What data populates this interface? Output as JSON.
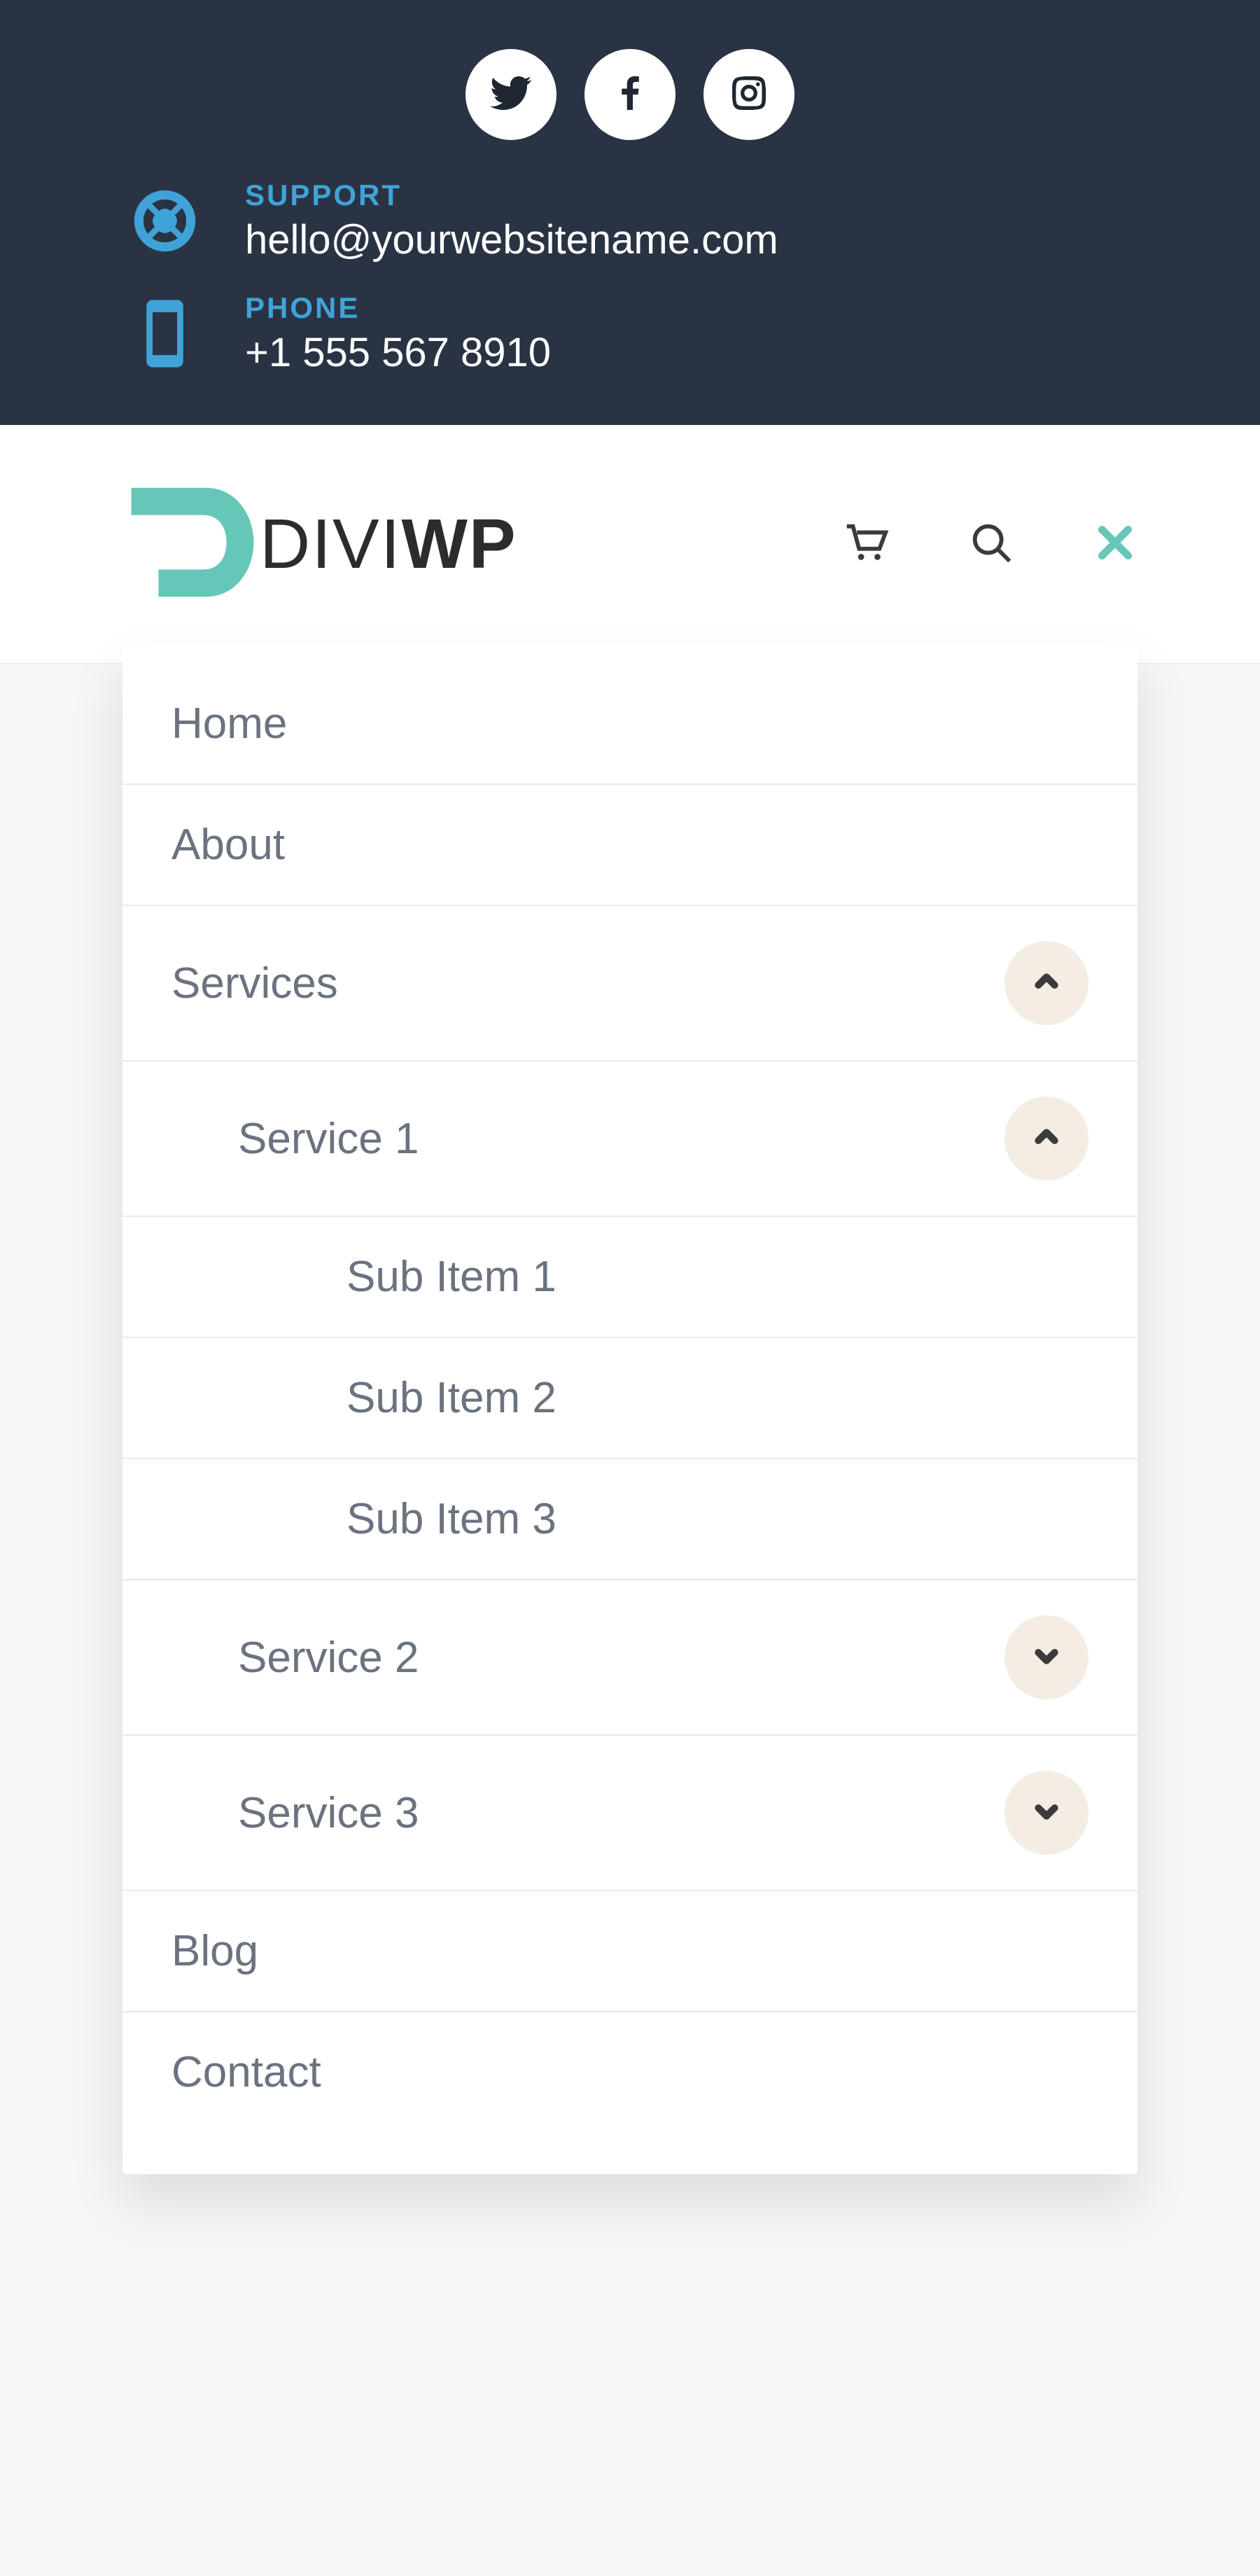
{
  "topbar": {
    "support": {
      "label": "SUPPORT",
      "value": "hello@yourwebsitename.com"
    },
    "phone": {
      "label": "PHONE",
      "value": "+1 555 567 8910"
    }
  },
  "logo": {
    "text_prefix": "DIVI",
    "text_bold": "WP"
  },
  "menu": {
    "home": "Home",
    "about": "About",
    "services": "Services",
    "service1": "Service 1",
    "sub1": "Sub Item 1",
    "sub2": "Sub Item 2",
    "sub3": "Sub Item 3",
    "service2": "Service 2",
    "service3": "Service 3",
    "blog": "Blog",
    "contact": "Contact"
  }
}
